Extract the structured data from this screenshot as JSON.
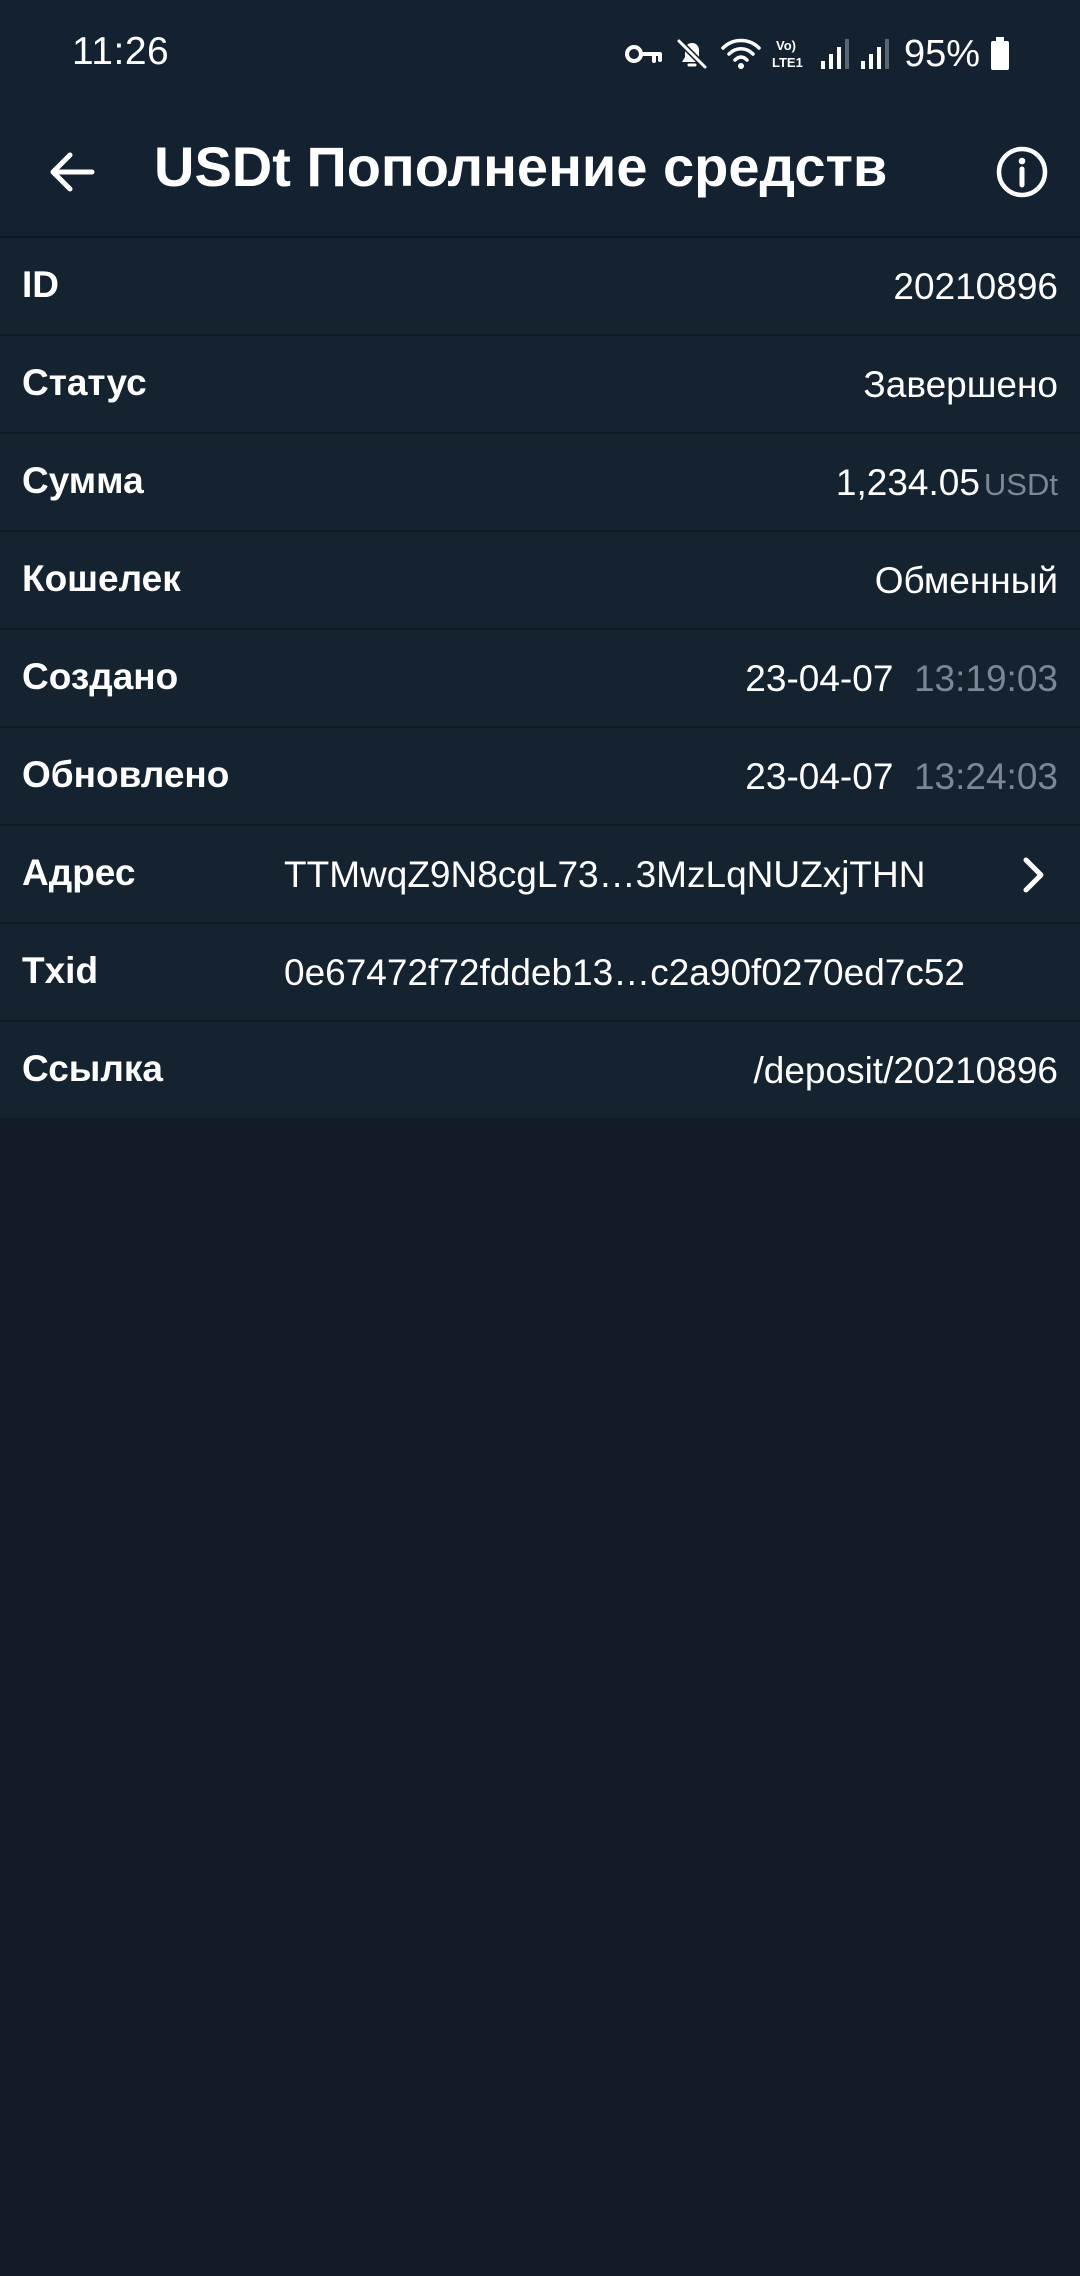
{
  "status_bar": {
    "time": "11:26",
    "network_label": "Vo) LTE1",
    "battery": "95%"
  },
  "app_bar": {
    "title": "USDt Пополнение средств",
    "back_icon": "arrow-left-icon",
    "info_icon": "info-circle-icon"
  },
  "details": {
    "id": {
      "label": "ID",
      "value": "20210896"
    },
    "status": {
      "label": "Статус",
      "value": "Завершено"
    },
    "amount": {
      "label": "Сумма",
      "value": "1,234.05",
      "unit": "USDt"
    },
    "wallet": {
      "label": "Кошелек",
      "value": "Обменный"
    },
    "created": {
      "label": "Создано",
      "date": "23-04-07",
      "time": "13:19:03"
    },
    "updated": {
      "label": "Обновлено",
      "date": "23-04-07",
      "time": "13:24:03"
    },
    "address": {
      "label": "Адрес",
      "value": "TTMwqZ9N8cgL73…3MzLqNUZxjTHN"
    },
    "txid": {
      "label": "Txid",
      "value": "0e67472f72fddeb13…c2a90f0270ed7c52"
    },
    "link": {
      "label": "Ссылка",
      "value": "/deposit/20210896"
    }
  },
  "colors": {
    "background": "#111c28",
    "surface": "#15222f",
    "text": "#ffffff",
    "muted": "#7b8794"
  }
}
